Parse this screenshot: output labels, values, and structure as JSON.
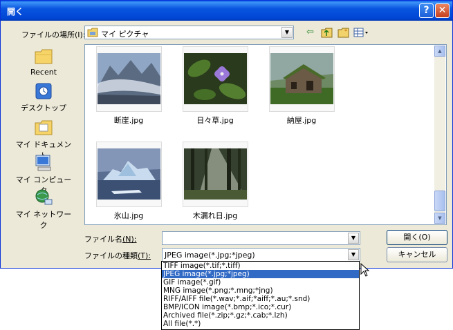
{
  "window": {
    "title": "開く"
  },
  "lookin": {
    "label": "ファイルの場所",
    "accel": "(I):",
    "value": "マイ ピクチャ"
  },
  "places": [
    {
      "label": "Recent",
      "icon": "recent-folder-icon"
    },
    {
      "label": "デスクトップ",
      "icon": "desktop-icon"
    },
    {
      "label": "マイ ドキュメント",
      "icon": "my-documents-icon"
    },
    {
      "label": "マイ コンピュータ",
      "icon": "my-computer-icon"
    },
    {
      "label": "マイ ネットワーク",
      "icon": "my-network-icon"
    }
  ],
  "files": [
    {
      "name": "断崖.jpg"
    },
    {
      "name": "日々草.jpg"
    },
    {
      "name": "納屋.jpg"
    },
    {
      "name": "氷山.jpg"
    },
    {
      "name": "木漏れ日.jpg"
    }
  ],
  "filename": {
    "label": "ファイル名",
    "accel": "(N):",
    "value": ""
  },
  "filetype": {
    "label": "ファイルの種類",
    "accel": "(T):",
    "value": "JPEG image(*.jpg;*jpeg)"
  },
  "buttons": {
    "open": "開く(O)",
    "cancel": "キャンセル"
  },
  "dropdown_options": [
    "TIFF image(*.tif;*.tiff)",
    "JPEG image(*.jpg;*jpeg)",
    "GIF image(*.gif)",
    "MNG image(*.png;*.mng;*jng)",
    "RIFF/AIFF file(*.wav;*.aif;*aiff;*.au;*.snd)",
    "BMP/ICON image(*.bmp;*.ico;*.cur)",
    "Archived file(*.zip;*.gz;*.cab;*.lzh)",
    "All file(*.*)"
  ],
  "selected_option_index": 1,
  "colors": {
    "titlebar": "#0054e3",
    "selection": "#316ac5",
    "dialog": "#ece9d8"
  }
}
